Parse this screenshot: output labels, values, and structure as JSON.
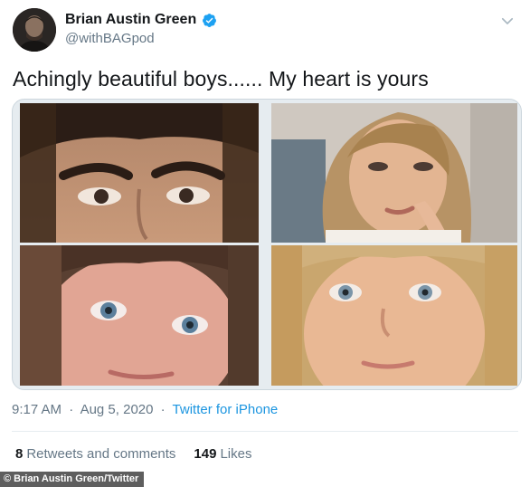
{
  "tweet": {
    "display_name": "Brian Austin Green",
    "handle": "@withBAGpod",
    "text": "Achingly beautiful boys...... My heart is yours",
    "time": "9:17 AM",
    "date": "Aug 5, 2020",
    "separator": "·",
    "source": "Twitter for iPhone",
    "retweets_count": "8",
    "retweets_label": "Retweets and comments",
    "likes_count": "149",
    "likes_label": "Likes"
  },
  "icons": {
    "verified": "verified-badge-icon",
    "more": "chevron-down-icon"
  },
  "colors": {
    "verified_blue": "#1da1f2",
    "link_blue": "#1b95e0",
    "muted_gray": "#657786"
  },
  "credit": "© Brian Austin Green/Twitter"
}
